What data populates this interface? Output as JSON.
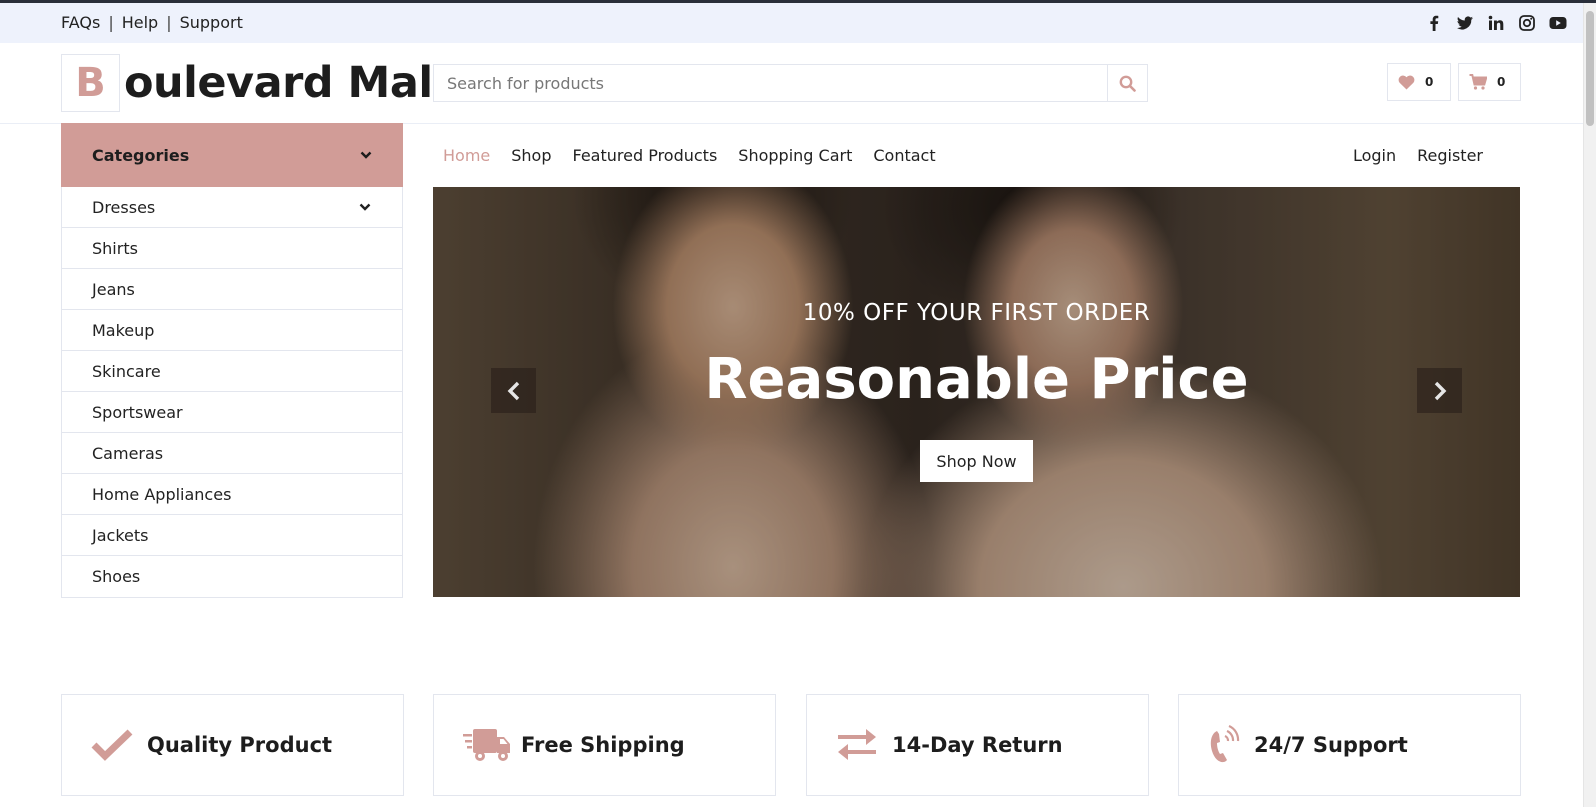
{
  "topbar": {
    "links": [
      "FAQs",
      "Help",
      "Support"
    ],
    "social_icons": [
      "facebook-icon",
      "twitter-icon",
      "linkedin-icon",
      "instagram-icon",
      "youtube-icon"
    ]
  },
  "header": {
    "logo_letter": "B",
    "logo_text": "oulevard Mall",
    "search_placeholder": "Search for products",
    "wishlist_count": "0",
    "cart_count": "0"
  },
  "categories": {
    "title": "Categories",
    "items": [
      "Dresses",
      "Shirts",
      "Jeans",
      "Makeup",
      "Skincare",
      "Sportswear",
      "Cameras",
      "Home Appliances",
      "Jackets",
      "Shoes"
    ]
  },
  "nav": {
    "items": [
      "Home",
      "Shop",
      "Featured Products",
      "Shopping Cart",
      "Contact"
    ],
    "active": "Home",
    "right": [
      "Login",
      "Register"
    ]
  },
  "hero": {
    "subtitle": "10% OFF YOUR FIRST ORDER",
    "title": "Reasonable Price",
    "button": "Shop Now"
  },
  "features": [
    {
      "icon": "check-icon",
      "label": "Quality Product"
    },
    {
      "icon": "truck-icon",
      "label": "Free Shipping"
    },
    {
      "icon": "exchange-icon",
      "label": "14-Day Return"
    },
    {
      "icon": "phone-icon",
      "label": "24/7 Support"
    }
  ],
  "colors": {
    "accent": "#d19c97",
    "topbar_bg": "#eef2fc",
    "text": "#1d1d1d"
  }
}
